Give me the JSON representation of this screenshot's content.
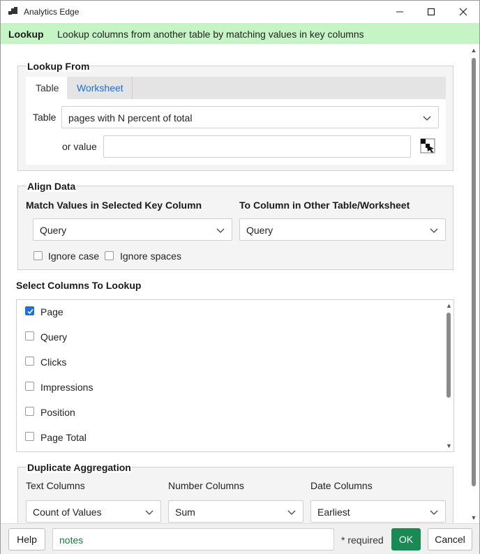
{
  "window": {
    "title": "Analytics Edge"
  },
  "banner": {
    "name": "Lookup",
    "description": "Lookup columns from another table by matching values in key columns"
  },
  "lookup_from": {
    "title": "Lookup From",
    "tabs": [
      {
        "label": "Table",
        "active": true
      },
      {
        "label": "Worksheet",
        "active": false
      }
    ],
    "table_label": "Table",
    "table_value": "pages with N percent of total",
    "or_value_label": "or value",
    "or_value_value": ""
  },
  "align_data": {
    "title": "Align Data",
    "match_label": "Match Values in Selected Key Column",
    "to_label": "To Column in Other Table/Worksheet",
    "match_value": "Query",
    "to_value": "Query",
    "ignore_case_label": "Ignore case",
    "ignore_spaces_label": "Ignore spaces"
  },
  "select_columns": {
    "title": "Select Columns To Lookup",
    "items": [
      {
        "label": "Page",
        "checked": true
      },
      {
        "label": "Query",
        "checked": false
      },
      {
        "label": "Clicks",
        "checked": false
      },
      {
        "label": "Impressions",
        "checked": false
      },
      {
        "label": "Position",
        "checked": false
      },
      {
        "label": "Page Total",
        "checked": false
      }
    ]
  },
  "duplicate_aggregation": {
    "title": "Duplicate Aggregation",
    "text_label": "Text Columns",
    "number_label": "Number Columns",
    "date_label": "Date Columns",
    "text_value": "Count of Values",
    "number_value": "Sum",
    "date_value": "Earliest"
  },
  "bottom": {
    "help_label": "Help",
    "notes_value": "notes",
    "required_label": "* required",
    "ok_label": "OK",
    "cancel_label": "Cancel"
  },
  "colors": {
    "banner_bg": "#c5f5c5",
    "tab_link": "#1a6fcf",
    "ok_bg": "#1a8a55",
    "checkbox_checked": "#1a73d9"
  }
}
